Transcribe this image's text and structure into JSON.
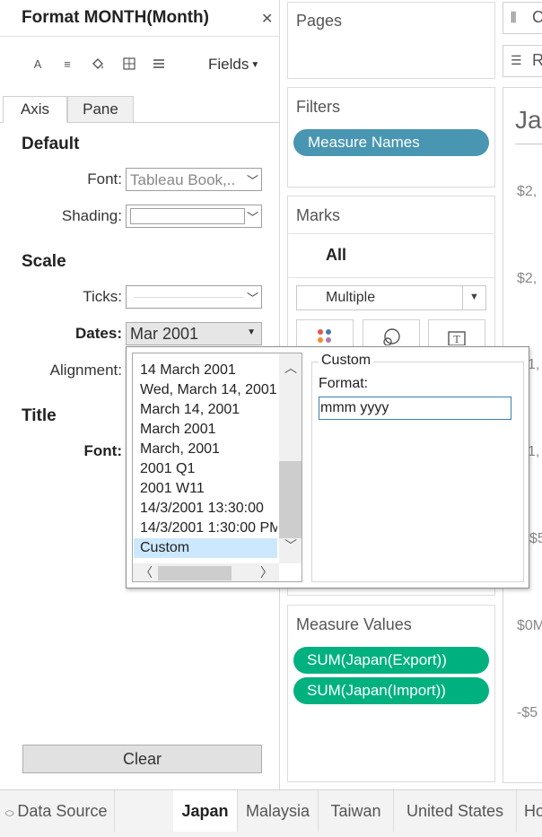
{
  "format_pane": {
    "title": "Format MONTH(Month)",
    "fields_label": "Fields",
    "tabs": [
      "Axis",
      "Pane"
    ],
    "default_section": {
      "heading": "Default",
      "font_label": "Font:",
      "font_value": "Tableau Book,..",
      "shading_label": "Shading:"
    },
    "scale_section": {
      "heading": "Scale",
      "ticks_label": "Ticks:",
      "dates_label": "Dates:",
      "dates_value": "Mar 2001",
      "alignment_label": "Alignment:"
    },
    "title_section": {
      "heading": "Title",
      "font_label": "Font:"
    },
    "clear_label": "Clear"
  },
  "date_popup": {
    "formats": [
      "14 March 2001",
      "Wed, March 14, 2001",
      "March 14, 2001",
      "March 2001",
      "March, 2001",
      "2001 Q1",
      "2001 W11",
      "14/3/2001 13:30:00",
      "14/3/2001 1:30:00 PM",
      "Custom"
    ],
    "selected_format": "Custom",
    "custom_legend": "Custom",
    "format_label": "Format:",
    "format_value": "mmm yyyy"
  },
  "shelves": {
    "pages_title": "Pages",
    "filters_title": "Filters",
    "filter_pills": [
      "Measure Names"
    ],
    "marks_title": "Marks",
    "marks_all": "All",
    "mark_type": "Multiple",
    "measure_values_title": "Measure Values",
    "measure_pills": [
      "SUM(Japan(Export))",
      "SUM(Japan(Import))"
    ]
  },
  "view": {
    "columns_label": "C",
    "rows_label": "R",
    "title": "Ja",
    "axis_ticks": [
      "$2,",
      "$2,",
      "1,",
      "1,",
      "$5",
      "$0M",
      "-$5"
    ]
  },
  "sheet_tabs": {
    "data_source": "Data Source",
    "tabs": [
      "Japan",
      "Malaysia",
      "Taiwan",
      "United States",
      "Ho"
    ],
    "active": "Japan"
  },
  "colors": {
    "filter_pill": "#4996b2",
    "measure_pill": "#00b180",
    "list_selection": "#cce8ff",
    "input_focus_border": "#3c7fb1"
  }
}
